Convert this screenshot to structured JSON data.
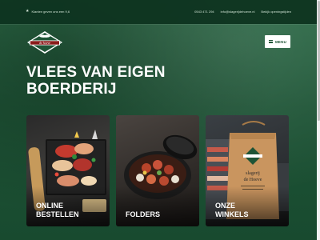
{
  "top_bar": {
    "tagline": "Klanten geven ons een 9,6",
    "phone": "0543 471 294",
    "email": "info@slagerijdehoeve.nl",
    "hours_link": "Bekijk openingstijden"
  },
  "logo": {
    "text": "de hoeve"
  },
  "menu": {
    "label": "MENU"
  },
  "hero": {
    "line1": "VLEES VAN EIGEN",
    "line2": "BOERDERIJ"
  },
  "cards": [
    {
      "line1": "ONLINE",
      "line2": "BESTELLEN"
    },
    {
      "line1": "FOLDERS",
      "line2": ""
    },
    {
      "line1": "ONZE",
      "line2": "WINKELS"
    }
  ],
  "bag_print": {
    "line1": "slagerij",
    "line2": "de Hoeve"
  },
  "colors": {
    "brand_green": "#1e5436",
    "top_bar": "#0e3420",
    "text": "#ffffff"
  },
  "icons": [
    "star-icon",
    "hamburger-icon"
  ]
}
